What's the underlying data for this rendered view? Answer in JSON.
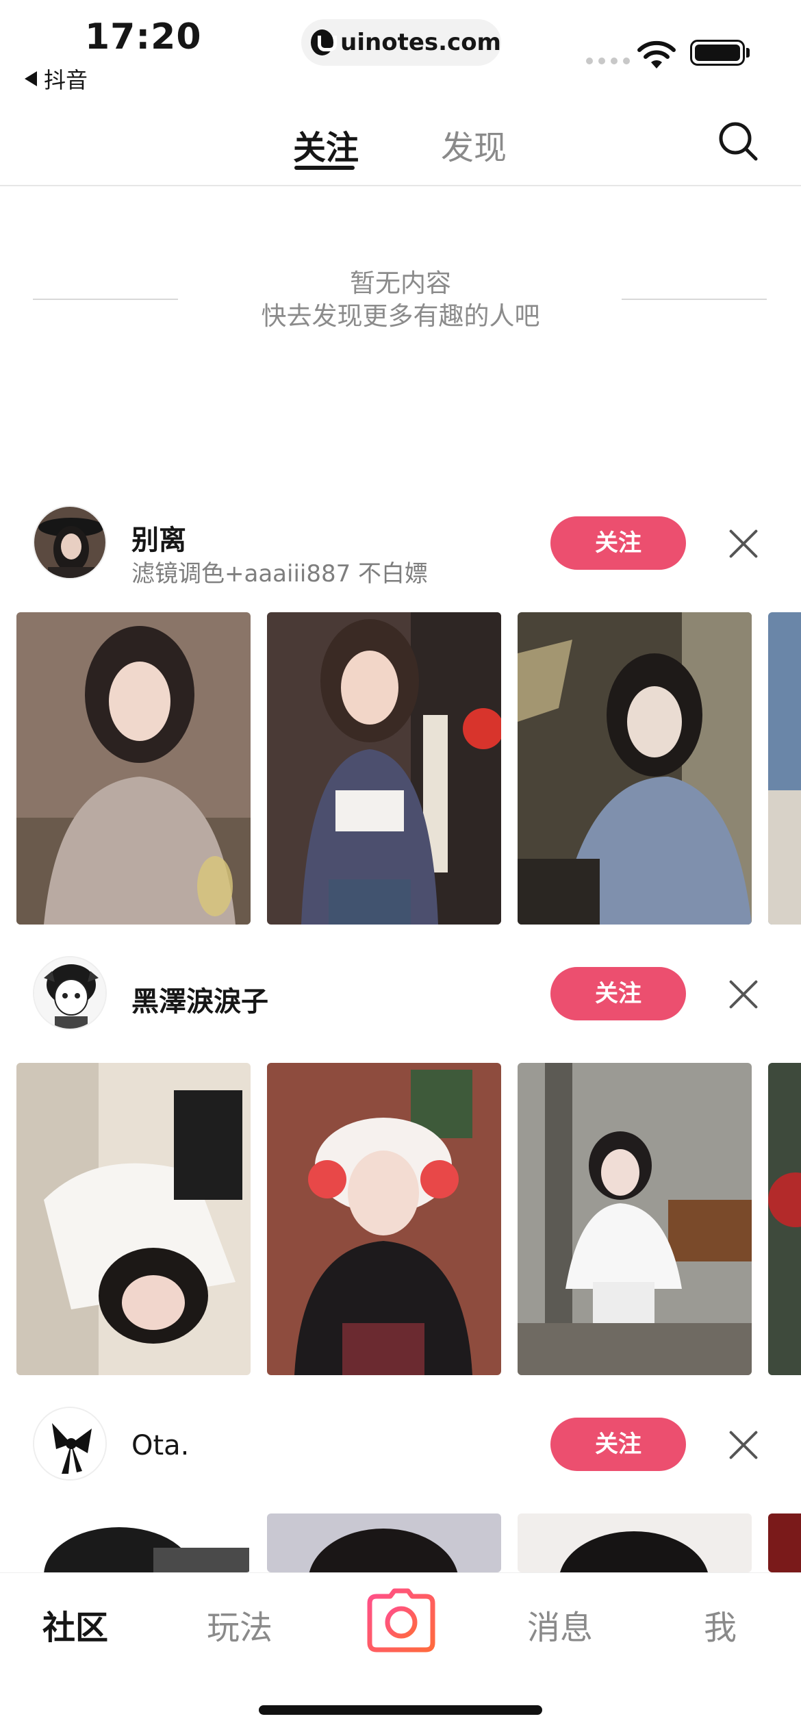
{
  "status_bar": {
    "time": "17:20",
    "back_app": "抖音",
    "url": "uinotes.com",
    "icons": [
      "signal-dots-icon",
      "wifi-icon",
      "battery-icon"
    ]
  },
  "top_tabs": [
    {
      "label": "关注",
      "active": true
    },
    {
      "label": "发现",
      "active": false
    }
  ],
  "empty_state": {
    "line1": "暂无内容",
    "line2": "快去发现更多有趣的人吧"
  },
  "recommended_users": [
    {
      "name": "别离",
      "desc": "滤镜调色+aaaiii887   不白嫖",
      "follow_label": "关注",
      "photos": 4
    },
    {
      "name": "黑澤淚淚子",
      "desc": "",
      "follow_label": "关注",
      "photos": 4
    },
    {
      "name": "Ota.",
      "desc": "",
      "follow_label": "关注",
      "photos": 4
    }
  ],
  "bottom_nav": [
    {
      "label": "社区",
      "active": true
    },
    {
      "label": "玩法",
      "active": false
    },
    {
      "label": "消息",
      "active": false
    },
    {
      "label": "我",
      "active": false
    }
  ],
  "colors": {
    "accent": "#ec4f6f",
    "text": "#161616",
    "muted": "#8a8a8a"
  }
}
